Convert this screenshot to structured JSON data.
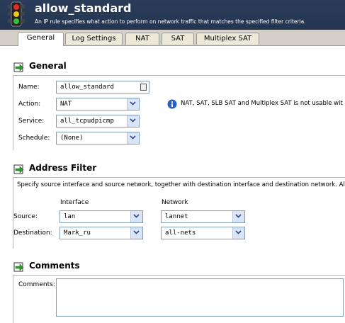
{
  "header": {
    "title": "allow_standard",
    "subtitle": "An IP rule specifies what action to perform on network traffic that matches the specified filter criteria.",
    "icon": "traffic-light-icon"
  },
  "tabs": [
    {
      "label": "General",
      "active": true
    },
    {
      "label": "Log Settings",
      "active": false
    },
    {
      "label": "NAT",
      "active": false
    },
    {
      "label": "SAT",
      "active": false
    },
    {
      "label": "Multiplex SAT",
      "active": false
    }
  ],
  "general": {
    "heading": "General",
    "name_label": "Name:",
    "name_value": "allow_standard",
    "action_label": "Action:",
    "action_value": "NAT",
    "service_label": "Service:",
    "service_value": "all_tcpudpicmp",
    "schedule_label": "Schedule:",
    "schedule_value": "(None)",
    "info_text": "NAT, SAT, SLB SAT and Multiplex SAT is not usable wit"
  },
  "address_filter": {
    "heading": "Address Filter",
    "description": "Specify source interface and source network, together with destination interface and destination network. All p",
    "col_interface": "Interface",
    "col_network": "Network",
    "source_label": "Source:",
    "source_interface": "lan",
    "source_network": "lannet",
    "destination_label": "Destination:",
    "destination_interface": "Mark_ru",
    "destination_network": "all-nets"
  },
  "comments": {
    "heading": "Comments",
    "label": "Comments:",
    "value": ""
  },
  "colors": {
    "header_bg": "#233550",
    "field_border": "#7f9db9",
    "dropdown_button": "#d9e4f7"
  }
}
